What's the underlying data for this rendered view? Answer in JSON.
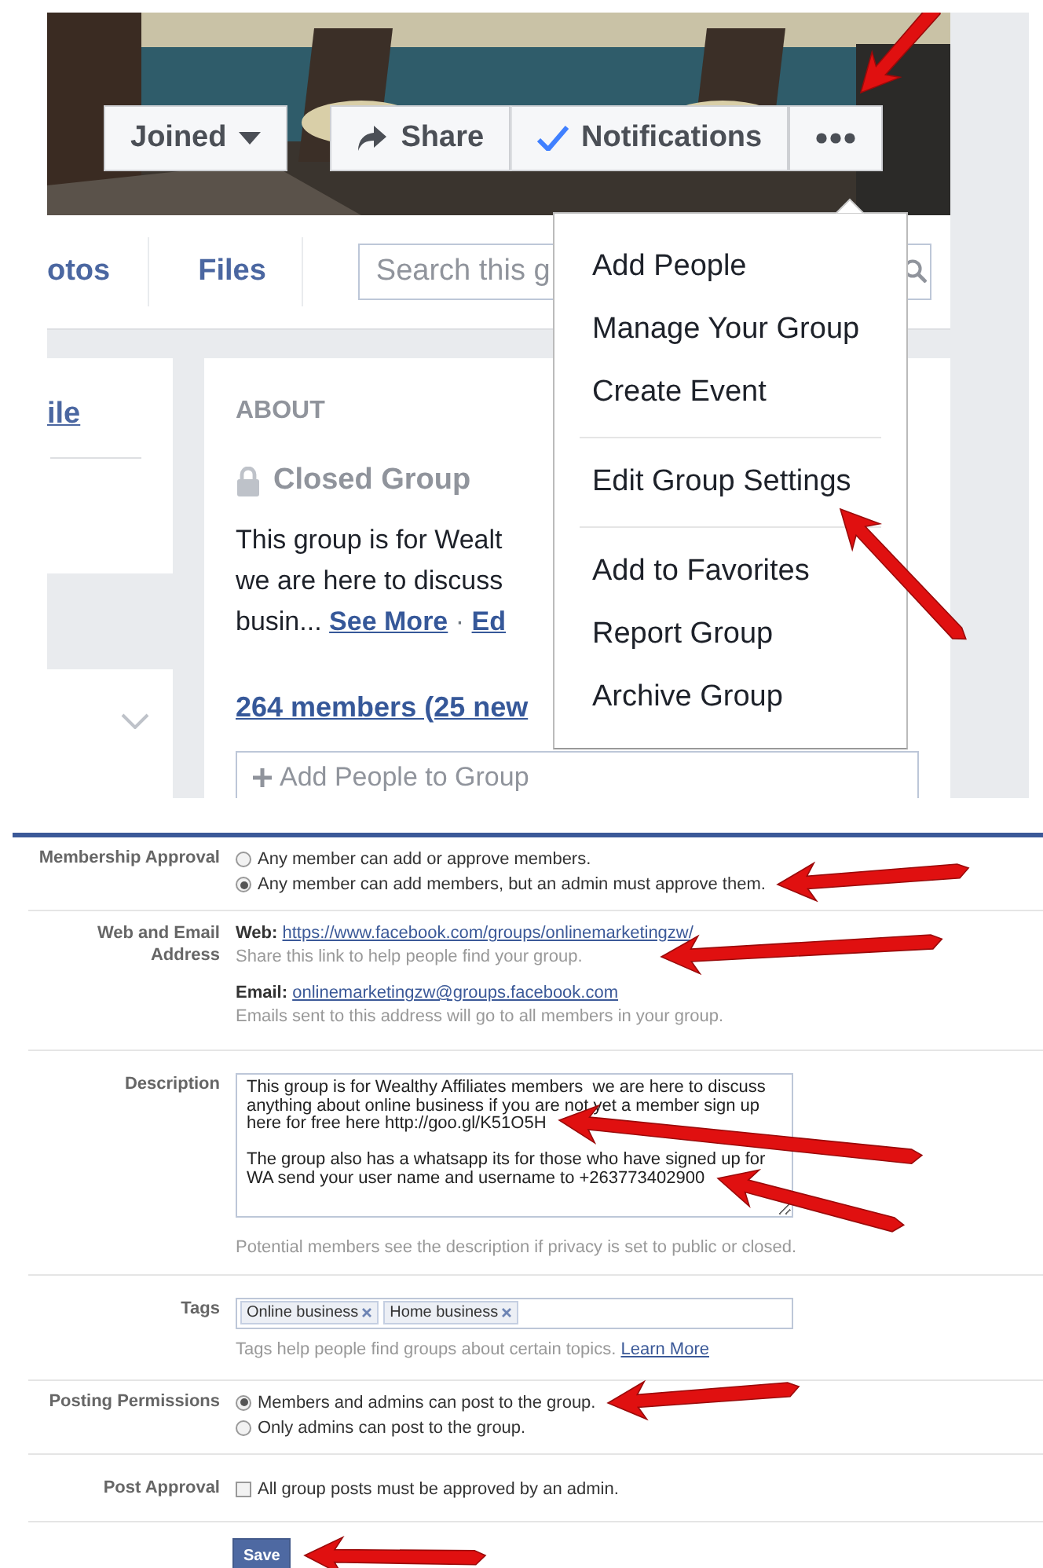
{
  "group_header": {
    "buttons": [
      {
        "kind": "dropdown",
        "label": "Joined"
      },
      {
        "kind": "share",
        "label": "Share"
      },
      {
        "kind": "check",
        "label": "Notifications"
      },
      {
        "kind": "more",
        "arrow": true
      }
    ],
    "tabs": [
      {
        "label": "otos"
      },
      {
        "label": "Files"
      }
    ],
    "search": {
      "placeholder": "Search this g"
    }
  },
  "left_card": {
    "link": "ile"
  },
  "about": {
    "heading": "ABOUT",
    "privacy": "Closed Group",
    "description_lines": [
      "This group is for Wealt",
      "we are here to discuss",
      "busin..."
    ],
    "see_more": "See More",
    "separator": "·",
    "edit": "Ed",
    "members": "264 members (25 new",
    "add_people_placeholder": "Add People to Group"
  },
  "menu": {
    "items": [
      {
        "kind": "item",
        "label": "Add People",
        "arrow": false
      },
      {
        "kind": "item",
        "label": "Manage Your Group",
        "arrow": false
      },
      {
        "kind": "item",
        "label": "Create Event",
        "arrow": false
      },
      {
        "kind": "divider"
      },
      {
        "kind": "item",
        "label": "Edit Group Settings",
        "arrow": true
      },
      {
        "kind": "divider"
      },
      {
        "kind": "item",
        "label": "Add to Favorites",
        "arrow": false
      },
      {
        "kind": "item",
        "label": "Report Group",
        "arrow": false
      },
      {
        "kind": "item",
        "label": "Archive Group",
        "arrow": false
      }
    ]
  },
  "settings": {
    "rows": [
      {
        "kind": "radio",
        "label": "Membership Approval",
        "options": [
          {
            "label": "Any member can add or approve members.",
            "selected": false,
            "arrow": false
          },
          {
            "label": "Any member can add members, but an admin must approve them.",
            "selected": true,
            "arrow": true
          }
        ]
      },
      {
        "kind": "address",
        "label": "Web and Email Address",
        "web_label": "Web:",
        "web_url": "https://www.facebook.com/groups/onlinemarketingzw/",
        "web_hint": "Share this link to help people find your group.",
        "arrow": true,
        "email_label": "Email:",
        "email": "onlinemarketingzw@groups.facebook.com",
        "email_hint": "Emails sent to this address will go to all members in your group."
      },
      {
        "kind": "textarea",
        "label": "Description",
        "value": "This group is for Wealthy Affiliates members  we are here to discuss anything about online business if you are not yet a member sign up here for free here http://goo.gl/K51O5H\n\nThe group also has a whatsapp its for those who have signed up for WA send your user name and username to +263773402900",
        "hint": "Potential members see the description if privacy is set to public or closed.",
        "arrow": true
      },
      {
        "kind": "tags",
        "label": "Tags",
        "tags": [
          "Online business",
          "Home business"
        ],
        "hint": "Tags help people find groups about certain topics.",
        "link": "Learn More"
      },
      {
        "kind": "radio",
        "label": "Posting Permissions",
        "options": [
          {
            "label": "Members and admins can post to the group.",
            "selected": true,
            "arrow": true
          },
          {
            "label": "Only admins can post to the group.",
            "selected": false,
            "arrow": false
          }
        ]
      },
      {
        "kind": "checkbox",
        "label": "Post Approval",
        "text": "All group posts must be approved by an admin.",
        "checked": false
      }
    ],
    "save": {
      "label": "Save",
      "arrow": true
    }
  }
}
